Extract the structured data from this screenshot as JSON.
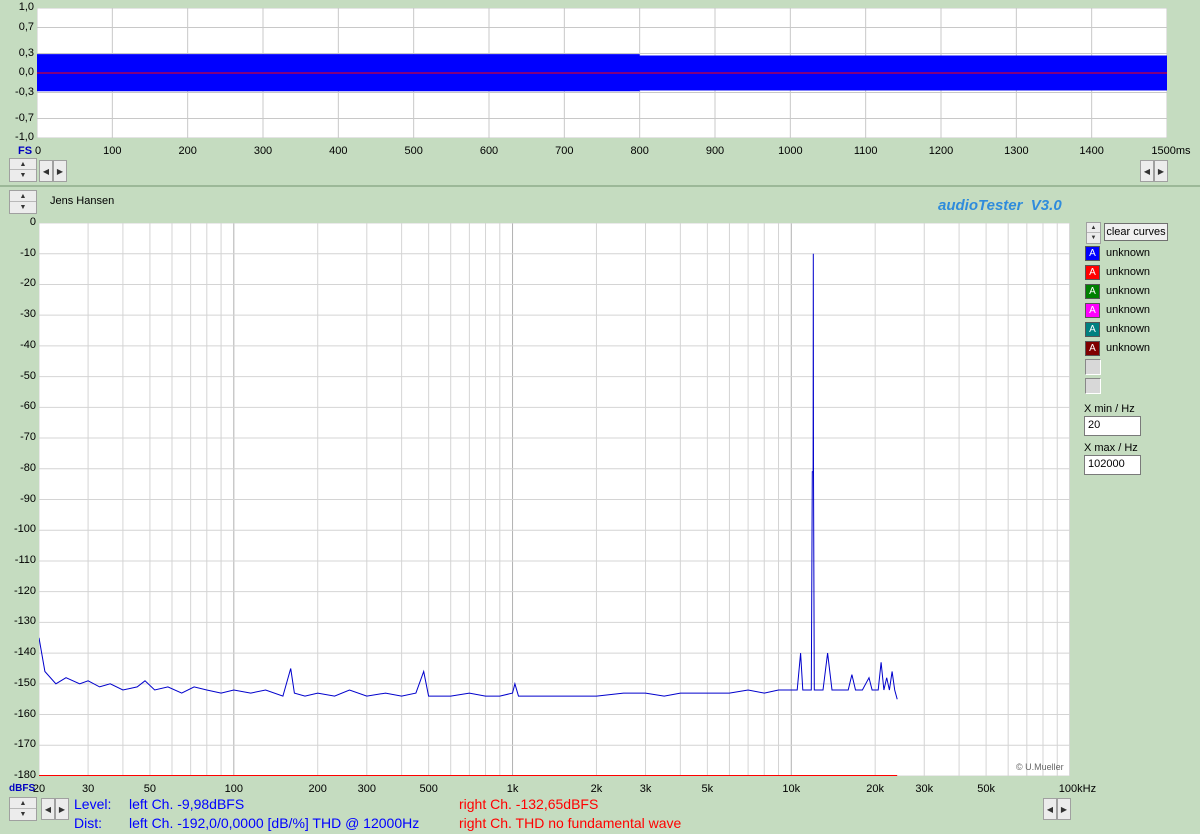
{
  "top_panel": {
    "y_ticks": [
      "1,0",
      "0,7",
      "0,3",
      "0,0",
      "-0,3",
      "-0,7",
      "-1,0"
    ],
    "fs_label": "FS",
    "x_ticks": [
      "0",
      "100",
      "200",
      "300",
      "400",
      "500",
      "600",
      "700",
      "800",
      "900",
      "1000",
      "1100",
      "1200",
      "1300",
      "1400",
      "1500ms"
    ]
  },
  "header": {
    "user": "Jens Hansen",
    "app_title": "audioTester  V3.0"
  },
  "spectrum": {
    "y_unit": "dBFS",
    "copyright": "© U.Mueller"
  },
  "controls": {
    "clear_label": "clear curves",
    "legend": [
      {
        "label": "unknown",
        "color": "#0000ff"
      },
      {
        "label": "unknown",
        "color": "#ff0000"
      },
      {
        "label": "unknown",
        "color": "#008000"
      },
      {
        "label": "unknown",
        "color": "#ff00ff"
      },
      {
        "label": "unknown",
        "color": "#008080"
      },
      {
        "label": "unknown",
        "color": "#800000"
      }
    ],
    "xmin_label": "X min / Hz",
    "xmin_value": "20",
    "xmax_label": "X max / Hz",
    "xmax_value": "102000"
  },
  "status": {
    "level_label": "Level:",
    "level_left": "left Ch. -9,98dBFS",
    "level_right": "right Ch. -132,65dBFS",
    "dist_label": "Dist:",
    "dist_left": "left Ch. -192,0/0,0000 [dB/%] THD @ 12000Hz",
    "dist_right": "right Ch. THD no fundamental wave"
  },
  "chart_data": [
    {
      "type": "area",
      "ylim": [
        -1.0,
        1.0
      ],
      "xlim": [
        0,
        1500
      ],
      "grid": true,
      "series": [
        {
          "color": "#0000ff",
          "envelope": [
            {
              "x": 0,
              "min": -0.28,
              "max": 0.29
            },
            {
              "x": 800,
              "min": -0.28,
              "max": 0.29
            },
            {
              "x": 800,
              "min": -0.27,
              "max": 0.27
            },
            {
              "x": 1500,
              "min": -0.27,
              "max": 0.27
            }
          ]
        },
        {
          "color": "#ff0000",
          "values": [
            {
              "x": 0,
              "y": 0.0
            },
            {
              "x": 1500,
              "y": 0.0
            }
          ]
        }
      ]
    },
    {
      "type": "line",
      "xscale": "log",
      "xlim": [
        20,
        100000
      ],
      "ylim": [
        -180,
        0
      ],
      "y_ticks": [
        0,
        -10,
        -20,
        -30,
        -40,
        -50,
        -60,
        -70,
        -80,
        -90,
        -100,
        -110,
        -120,
        -130,
        -140,
        -150,
        -160,
        -170,
        -180
      ],
      "x_tick_labels": [
        {
          "v": 20,
          "t": "20"
        },
        {
          "v": 30,
          "t": "30"
        },
        {
          "v": 50,
          "t": "50"
        },
        {
          "v": 100,
          "t": "100"
        },
        {
          "v": 200,
          "t": "200"
        },
        {
          "v": 300,
          "t": "300"
        },
        {
          "v": 500,
          "t": "500"
        },
        {
          "v": 1000,
          "t": "1k"
        },
        {
          "v": 2000,
          "t": "2k"
        },
        {
          "v": 3000,
          "t": "3k"
        },
        {
          "v": 5000,
          "t": "5k"
        },
        {
          "v": 10000,
          "t": "10k"
        },
        {
          "v": 20000,
          "t": "20k"
        },
        {
          "v": 30000,
          "t": "30k"
        },
        {
          "v": 50000,
          "t": "50k"
        },
        {
          "v": 100000,
          "t": "100kHz"
        }
      ],
      "grid": true,
      "series": [
        {
          "color": "#0000cc",
          "points": [
            [
              20,
              -135
            ],
            [
              21,
              -146
            ],
            [
              23,
              -150
            ],
            [
              25,
              -148
            ],
            [
              28,
              -150
            ],
            [
              30,
              -149
            ],
            [
              33,
              -151
            ],
            [
              36,
              -150
            ],
            [
              40,
              -152
            ],
            [
              45,
              -151
            ],
            [
              48,
              -149
            ],
            [
              52,
              -152
            ],
            [
              58,
              -151
            ],
            [
              65,
              -153
            ],
            [
              72,
              -151
            ],
            [
              80,
              -152
            ],
            [
              90,
              -153
            ],
            [
              100,
              -152
            ],
            [
              115,
              -153
            ],
            [
              130,
              -152
            ],
            [
              150,
              -154
            ],
            [
              160,
              -145
            ],
            [
              165,
              -153
            ],
            [
              180,
              -154
            ],
            [
              200,
              -153
            ],
            [
              230,
              -154
            ],
            [
              260,
              -152
            ],
            [
              300,
              -154
            ],
            [
              350,
              -153
            ],
            [
              400,
              -154
            ],
            [
              450,
              -153
            ],
            [
              480,
              -146
            ],
            [
              500,
              -154
            ],
            [
              600,
              -154
            ],
            [
              700,
              -153
            ],
            [
              800,
              -154
            ],
            [
              900,
              -154
            ],
            [
              1000,
              -153
            ],
            [
              1020,
              -150
            ],
            [
              1050,
              -154
            ],
            [
              1200,
              -154
            ],
            [
              1500,
              -154
            ],
            [
              2000,
              -154
            ],
            [
              2500,
              -153
            ],
            [
              3000,
              -153
            ],
            [
              3500,
              -154
            ],
            [
              4000,
              -153
            ],
            [
              5000,
              -153
            ],
            [
              6000,
              -153
            ],
            [
              7000,
              -152
            ],
            [
              8000,
              -153
            ],
            [
              9000,
              -152
            ],
            [
              10000,
              -152
            ],
            [
              10500,
              -152
            ],
            [
              10800,
              -140
            ],
            [
              11000,
              -152
            ],
            [
              11800,
              -152
            ],
            [
              11900,
              -81
            ],
            [
              11980,
              -81
            ],
            [
              12000,
              -10
            ],
            [
              12020,
              -81
            ],
            [
              12100,
              -152
            ],
            [
              13000,
              -152
            ],
            [
              13500,
              -140
            ],
            [
              14000,
              -152
            ],
            [
              16000,
              -152
            ],
            [
              16500,
              -147
            ],
            [
              17000,
              -152
            ],
            [
              18000,
              -152
            ],
            [
              19000,
              -148
            ],
            [
              19500,
              -152
            ],
            [
              20500,
              -152
            ],
            [
              21000,
              -143
            ],
            [
              21500,
              -152
            ],
            [
              22000,
              -148
            ],
            [
              22500,
              -152
            ],
            [
              23000,
              -146
            ],
            [
              23500,
              -152
            ],
            [
              24000,
              -155
            ]
          ]
        },
        {
          "color": "#ff0000",
          "points": [
            [
              20,
              -180
            ],
            [
              24000,
              -180
            ]
          ]
        }
      ]
    }
  ]
}
